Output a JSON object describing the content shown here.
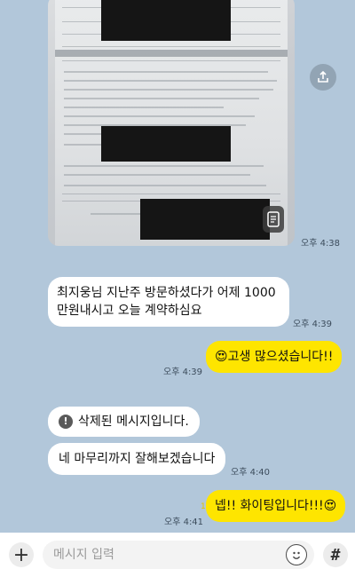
{
  "messages": [
    {
      "type": "image",
      "time": "오후 4:38"
    },
    {
      "type": "text",
      "direction": "in",
      "lines": [
        "최지웅님 지난주 방문하셨다가 어제 1000",
        "만원내시고 오늘 계약하심요"
      ],
      "time": "오후 4:39"
    },
    {
      "type": "text",
      "direction": "out",
      "emoji": "😍",
      "text": "고생 많으셨습니다!!",
      "time": "오후 4:39"
    },
    {
      "type": "deleted",
      "direction": "in",
      "text": "삭제된 메시지입니다."
    },
    {
      "type": "text",
      "direction": "in",
      "text": "네 마무리까지 잘해보겠습니다",
      "time": "오후 4:40"
    },
    {
      "type": "text",
      "direction": "out",
      "text": "넵!! 화이팅입니다!!!",
      "emoji": "😍",
      "time": "오후 4:41",
      "unread": "1"
    }
  ],
  "input": {
    "placeholder": "메시지 입력"
  },
  "icons": {
    "plus": "plus-icon",
    "emoji": "emoji-icon",
    "hash": "hash-icon",
    "share": "share-icon"
  },
  "colors": {
    "background": "#b2c7da",
    "outgoing": "#fee500",
    "incoming": "#ffffff"
  }
}
